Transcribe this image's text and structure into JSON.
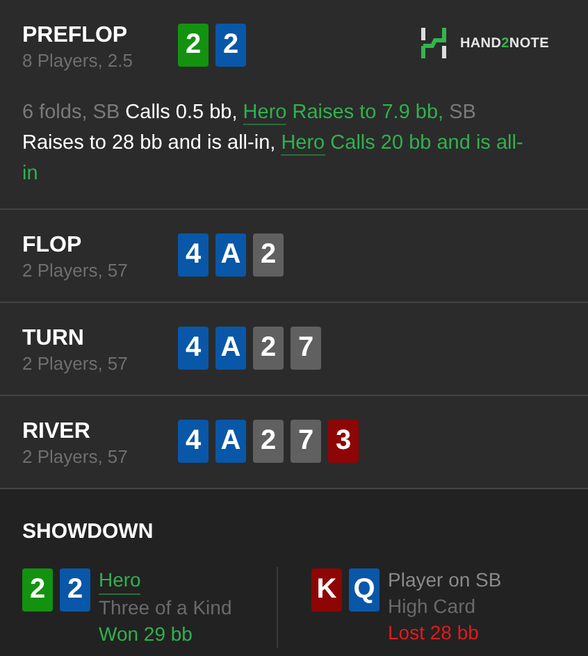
{
  "streets": [
    {
      "name": "PREFLOP",
      "info": "8 Players, 2.5",
      "cards": [
        {
          "rank": "2",
          "color": "#13920f"
        },
        {
          "rank": "2",
          "color": "#0957a8"
        }
      ],
      "logo": {
        "parts": [
          {
            "text": "HAND",
            "accent": false
          },
          {
            "text": "2",
            "accent": true
          },
          {
            "text": "NOTE",
            "accent": false
          }
        ]
      },
      "actions": [
        {
          "kind": "fold",
          "text": "6 folds, SB"
        },
        {
          "kind": "villain",
          "text": "Calls 0.5 bb,"
        },
        {
          "kind": "hero",
          "actor": "Hero",
          "text": "Raises to 7.9 bb,"
        },
        {
          "kind": "fold",
          "text": "SB"
        },
        {
          "kind": "villain",
          "text": "Raises to 28 bb and is all-in,"
        },
        {
          "kind": "hero",
          "actor": "Hero",
          "text": "Calls 20 bb and is all-in"
        }
      ]
    },
    {
      "name": "FLOP",
      "info": "2 Players, 57",
      "cards": [
        {
          "rank": "4",
          "color": "#0957a8"
        },
        {
          "rank": "A",
          "color": "#0957a8"
        },
        {
          "rank": "2",
          "color": "#606060"
        }
      ]
    },
    {
      "name": "TURN",
      "info": "2 Players, 57",
      "cards": [
        {
          "rank": "4",
          "color": "#0957a8"
        },
        {
          "rank": "A",
          "color": "#0957a8"
        },
        {
          "rank": "2",
          "color": "#606060"
        },
        {
          "rank": "7",
          "color": "#606060"
        }
      ]
    },
    {
      "name": "RIVER",
      "info": "2 Players, 57",
      "cards": [
        {
          "rank": "4",
          "color": "#0957a8"
        },
        {
          "rank": "A",
          "color": "#0957a8"
        },
        {
          "rank": "2",
          "color": "#606060"
        },
        {
          "rank": "7",
          "color": "#606060"
        },
        {
          "rank": "3",
          "color": "#8e0505"
        }
      ]
    }
  ],
  "showdown": {
    "title": "SHOWDOWN",
    "players": [
      {
        "name": "Hero",
        "is_hero": true,
        "hand": "Three of a Kind",
        "result": "Won 29 bb",
        "won": true,
        "cards": [
          {
            "rank": "2",
            "color": "#13920f"
          },
          {
            "rank": "2",
            "color": "#0957a8"
          }
        ]
      },
      {
        "name": "Player on SB",
        "is_hero": false,
        "hand": "High Card",
        "result": "Lost 28 bb",
        "won": false,
        "cards": [
          {
            "rank": "K",
            "color": "#8e0505"
          },
          {
            "rank": "Q",
            "color": "#0957a8"
          }
        ]
      }
    ]
  }
}
